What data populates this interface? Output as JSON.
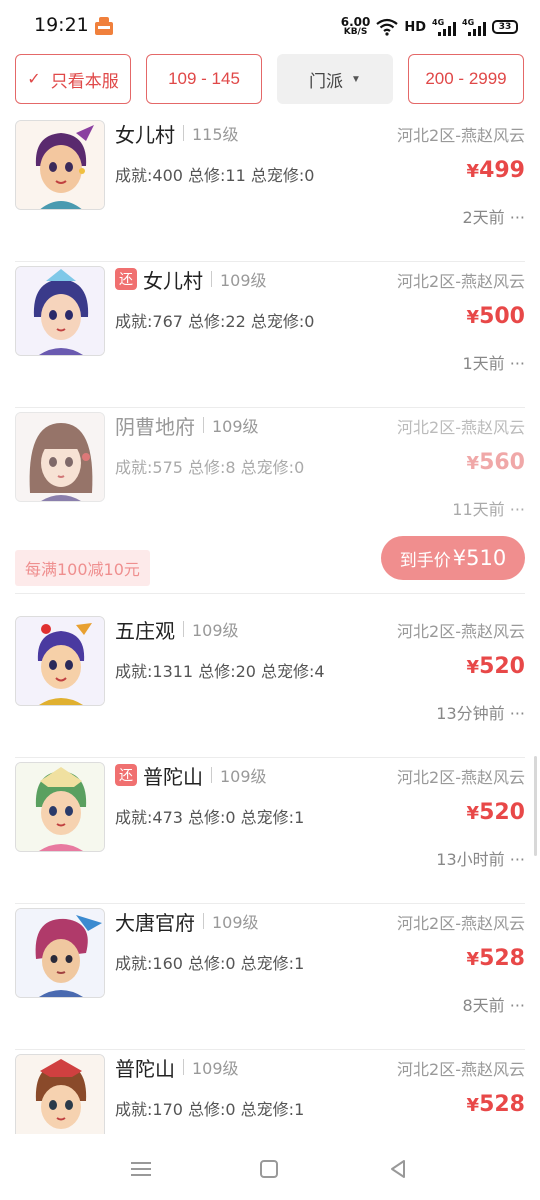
{
  "status_bar": {
    "time": "19:21",
    "net_speed_value": "6.00",
    "net_speed_unit": "KB/S",
    "hd": "HD",
    "net1": "4G",
    "net2": "4G",
    "battery": "33"
  },
  "filters": {
    "only_this_server": "只看本服",
    "level_range": "109 - 145",
    "sect": "门派",
    "price_range": "200 - 2999"
  },
  "items": [
    {
      "returned": false,
      "return_tag": "",
      "name": "女儿村",
      "level": "115级",
      "server": "河北2区-燕赵风云",
      "stats": "成就:400 总修:11 总宠修:0",
      "price": "499",
      "time": "2天前",
      "more": "···"
    },
    {
      "returned": true,
      "return_tag": "还",
      "name": "女儿村",
      "level": "109级",
      "server": "河北2区-燕赵风云",
      "stats": "成就:767 总修:22 总宠修:0",
      "price": "500",
      "time": "1天前",
      "more": "···"
    },
    {
      "returned": false,
      "return_tag": "",
      "name": "阴曹地府",
      "level": "109级",
      "server": "河北2区-燕赵风云",
      "stats": "成就:575 总修:8 总宠修:0",
      "price": "560",
      "time": "11天前",
      "more": "···"
    },
    {
      "returned": false,
      "return_tag": "",
      "name": "五庄观",
      "level": "109级",
      "server": "河北2区-燕赵风云",
      "stats": "成就:1311 总修:20 总宠修:4",
      "price": "520",
      "time": "13分钟前",
      "more": "···"
    },
    {
      "returned": true,
      "return_tag": "还",
      "name": "普陀山",
      "level": "109级",
      "server": "河北2区-燕赵风云",
      "stats": "成就:473 总修:0 总宠修:1",
      "price": "520",
      "time": "13小时前",
      "more": "···"
    },
    {
      "returned": false,
      "return_tag": "",
      "name": "大唐官府",
      "level": "109级",
      "server": "河北2区-燕赵风云",
      "stats": "成就:160 总修:0 总宠修:1",
      "price": "528",
      "time": "8天前",
      "more": "···"
    },
    {
      "returned": false,
      "return_tag": "",
      "name": "普陀山",
      "level": "109级",
      "server": "河北2区-燕赵风云",
      "stats": "成就:170 总修:0 总宠修:1",
      "price": "528",
      "time": "",
      "more": ""
    }
  ],
  "currency_symbol": "¥",
  "promo": {
    "tag": "每满100减10元",
    "final_label": "到手价",
    "final_price": "¥510"
  },
  "colors": {
    "accent_red": "#e84848",
    "faded_price": "#f0a8a8",
    "promo_bg": "#fdeaea",
    "final_btn": "#f08e8e"
  }
}
